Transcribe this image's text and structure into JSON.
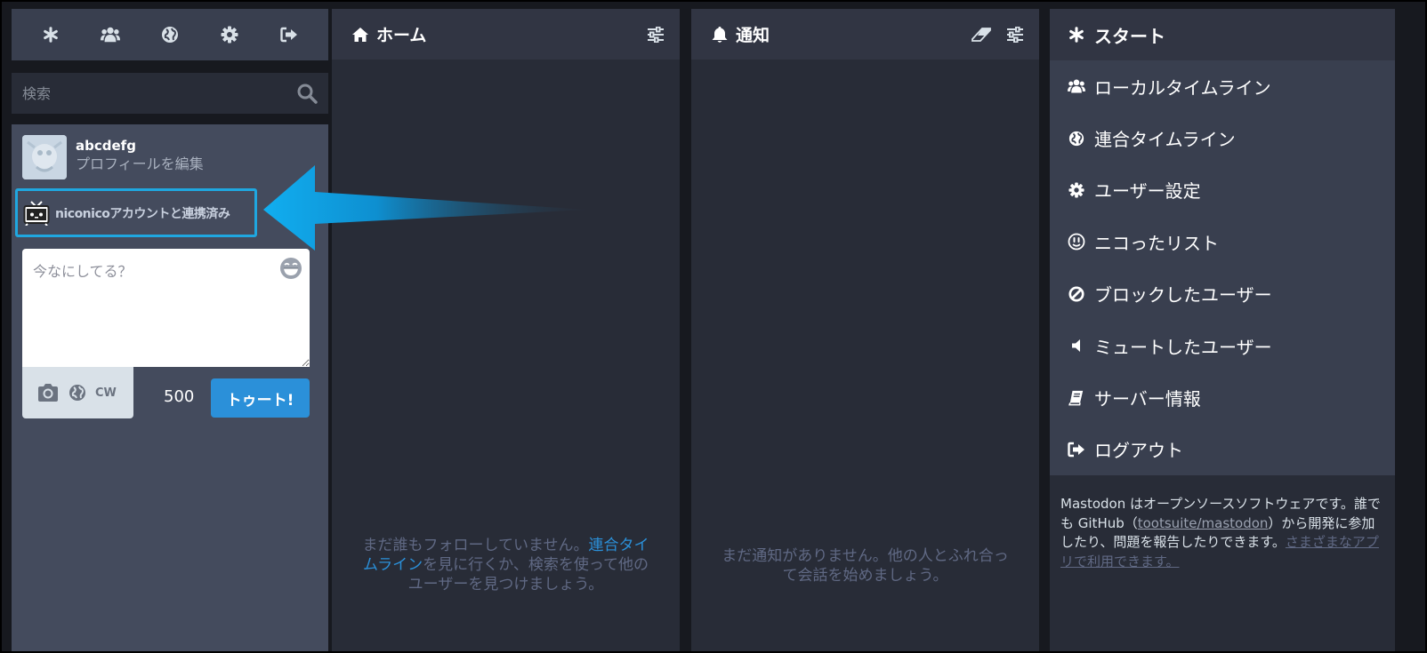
{
  "drawer": {
    "header_icons": [
      "asterisk-icon",
      "users-icon",
      "globe-icon",
      "gear-icon",
      "sign-out-icon"
    ],
    "search": {
      "placeholder": "検索",
      "icon": "search-icon"
    },
    "account": {
      "name": "abcdefg",
      "edit_label": "プロフィールを編集"
    },
    "niconico": {
      "label": "niconicoアカウントと連携済み",
      "icon": "niconico-tv-icon"
    },
    "compose": {
      "placeholder": "今なにしてる？",
      "emoji_icon": "laughing-emoji-icon",
      "tools": [
        "camera-icon",
        "globe-icon"
      ],
      "cw_label": "CW",
      "char_count": "500",
      "toot_label": "トゥート!"
    }
  },
  "home": {
    "title": "ホーム",
    "empty_before": "まだ誰もフォローしていません。",
    "empty_link": "連合タイムライン",
    "empty_after": "を見に行くか、検索を使って他のユーザーを見つけましょう。"
  },
  "notifications": {
    "title": "通知",
    "empty": "まだ通知がありません。他の人とふれ合って会話を始めましょう。"
  },
  "getting_started": {
    "title": "スタート",
    "items": [
      {
        "label": "ローカルタイムライン",
        "icon": "users-icon"
      },
      {
        "label": "連合タイムライン",
        "icon": "globe-icon"
      },
      {
        "label": "ユーザー設定",
        "icon": "gear-icon"
      },
      {
        "label": "ニコったリスト",
        "icon": "nico-face-icon"
      },
      {
        "label": "ブロックしたユーザー",
        "icon": "ban-icon"
      },
      {
        "label": "ミュートしたユーザー",
        "icon": "volume-off-icon"
      },
      {
        "label": "サーバー情報",
        "icon": "book-icon"
      },
      {
        "label": "ログアウト",
        "icon": "sign-out-icon"
      }
    ],
    "footer": {
      "text1": "Mastodon はオープンソースソフトウェアです。誰でも GitHub（",
      "repo_link": "tootsuite/mastodon",
      "text2": "）から開発に参加したり、問題を報告したりできます。",
      "apps_link": "さまざまなアプリで利用できます。"
    }
  },
  "colors": {
    "accent": "#2b90d9",
    "highlight_border": "#1fa7e0",
    "background": "#17191f",
    "column": "#282c37",
    "header": "#313543"
  }
}
